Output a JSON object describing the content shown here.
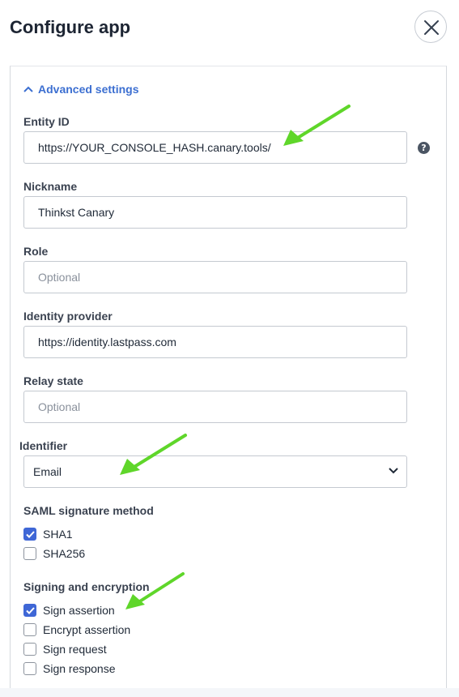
{
  "dialog": {
    "title": "Configure app"
  },
  "advanced": {
    "toggle_label": "Advanced settings"
  },
  "fields": {
    "entity_id": {
      "label": "Entity ID",
      "value": "https://YOUR_CONSOLE_HASH.canary.tools/"
    },
    "nickname": {
      "label": "Nickname",
      "value": "Thinkst Canary"
    },
    "role": {
      "label": "Role",
      "placeholder": "Optional"
    },
    "identity_provider": {
      "label": "Identity provider",
      "value": "https://identity.lastpass.com"
    },
    "relay_state": {
      "label": "Relay state",
      "placeholder": "Optional"
    },
    "identifier": {
      "label": "Identifier",
      "selected": "Email"
    }
  },
  "saml_signature": {
    "label": "SAML signature method",
    "options": [
      {
        "label": "SHA1",
        "checked": true
      },
      {
        "label": "SHA256",
        "checked": false
      }
    ]
  },
  "signing": {
    "label": "Signing and encryption",
    "options": [
      {
        "label": "Sign assertion",
        "checked": true
      },
      {
        "label": "Encrypt assertion",
        "checked": false
      },
      {
        "label": "Sign request",
        "checked": false
      },
      {
        "label": "Sign response",
        "checked": false
      }
    ]
  },
  "help_icon_glyph": "?",
  "colors": {
    "accent": "#3f67d6",
    "link": "#3c6fd1",
    "annotation_arrow": "#5fd62a"
  }
}
